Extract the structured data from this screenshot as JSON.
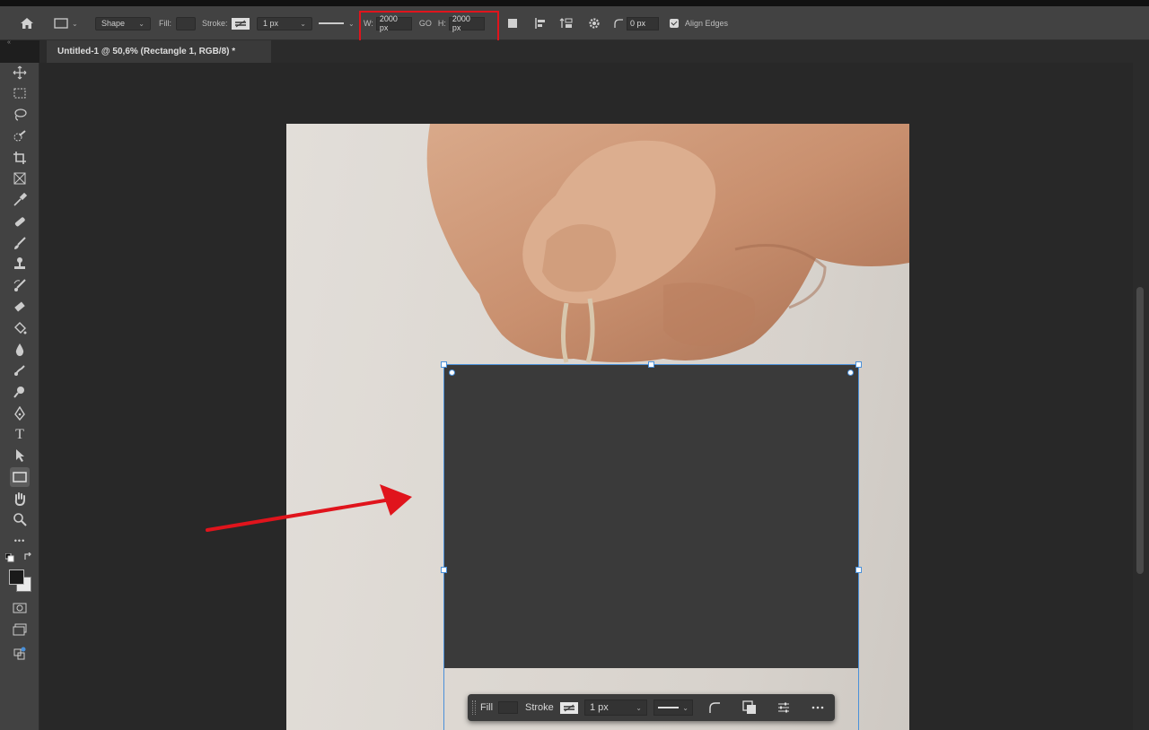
{
  "options_bar": {
    "mode_label": "Shape",
    "fill_label": "Fill:",
    "stroke_label": "Stroke:",
    "stroke_width": "1 px",
    "width_label": "W:",
    "width_value": "2000 px",
    "link_label": "GO",
    "height_label": "H:",
    "height_value": "2000 px",
    "corner_radius": "0 px",
    "align_edges_label": "Align Edges",
    "align_edges_checked": true
  },
  "document_tab": {
    "title": "Untitled-1 @ 50,6% (Rectangle 1, RGB/8) *"
  },
  "toolbar": {
    "tools": [
      {
        "icon": "move-icon"
      },
      {
        "icon": "marquee-icon"
      },
      {
        "icon": "lasso-icon"
      },
      {
        "icon": "quick-selection-icon"
      },
      {
        "icon": "crop-icon"
      },
      {
        "icon": "frame-icon"
      },
      {
        "icon": "eyedropper-icon"
      },
      {
        "icon": "healing-brush-icon"
      },
      {
        "icon": "brush-icon"
      },
      {
        "icon": "clone-stamp-icon"
      },
      {
        "icon": "history-brush-icon"
      },
      {
        "icon": "eraser-icon"
      },
      {
        "icon": "paint-bucket-icon"
      },
      {
        "icon": "blur-icon"
      },
      {
        "icon": "smudge-icon"
      },
      {
        "icon": "dodge-icon"
      },
      {
        "icon": "pen-icon"
      },
      {
        "icon": "type-icon",
        "glyph": "T"
      },
      {
        "icon": "path-selection-icon"
      },
      {
        "icon": "rectangle-icon",
        "active": true
      },
      {
        "icon": "hand-icon"
      },
      {
        "icon": "zoom-icon"
      },
      {
        "icon": "more-tools-icon",
        "glyph": "•••"
      }
    ]
  },
  "contextual_bar": {
    "fill_label": "Fill",
    "stroke_label": "Stroke",
    "stroke_width": "1 px"
  },
  "colors": {
    "accent_selection": "#4a90d9",
    "annotation_red": "#e0141c",
    "shape_fill": "#3a3a3a",
    "ui_panel": "#424242"
  }
}
